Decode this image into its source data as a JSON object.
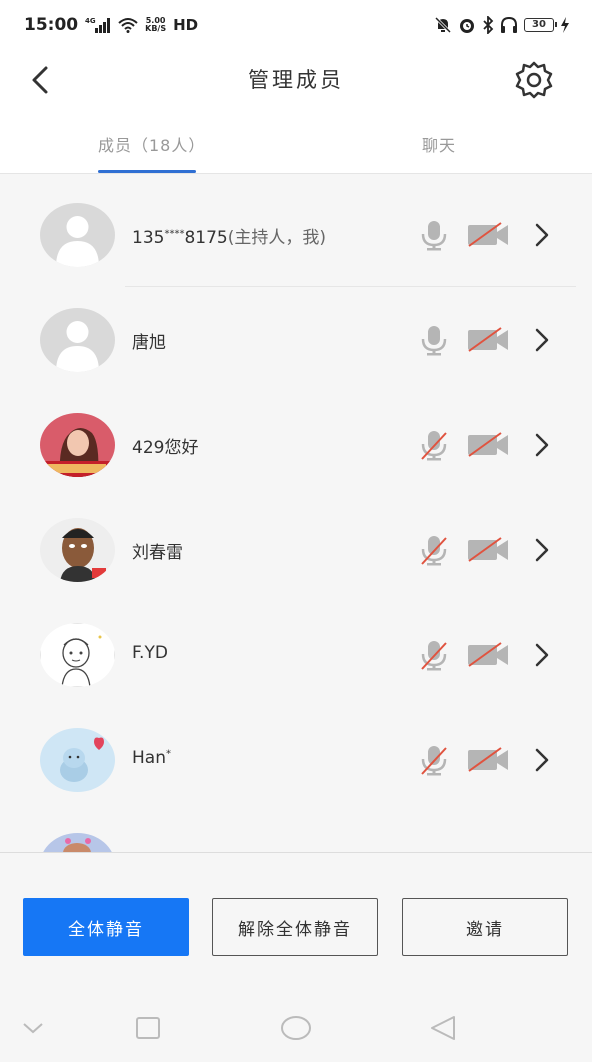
{
  "status_bar": {
    "time": "15:00",
    "signal_type": "4G",
    "net_speed_value": "5.00",
    "net_speed_unit": "KB/S",
    "hd": "HD",
    "battery": "30"
  },
  "header": {
    "title": "管理成员"
  },
  "tabs": {
    "members": "成员（18人）",
    "chat": "聊天"
  },
  "members": [
    {
      "name": "135",
      "name_mid": "****",
      "name_end": "8175",
      "role": "(主持人，我)",
      "avatar": "default",
      "mic_muted": false,
      "camera_off": true
    },
    {
      "name": "唐旭",
      "avatar": "default",
      "mic_muted": false,
      "camera_off": true
    },
    {
      "name": "429您好",
      "avatar": "photo",
      "mic_muted": true,
      "camera_off": true
    },
    {
      "name": "刘春雷",
      "avatar": "cartoon-man",
      "mic_muted": true,
      "camera_off": true
    },
    {
      "name": "F.YD",
      "avatar": "sketch",
      "mic_muted": true,
      "camera_off": true
    },
    {
      "name": "Han",
      "name_sup": "*",
      "avatar": "cartoon-bear",
      "mic_muted": true,
      "camera_off": true
    }
  ],
  "buttons": {
    "mute_all": "全体静音",
    "unmute_all": "解除全体静音",
    "invite": "邀请"
  },
  "colors": {
    "accent": "#1677f5",
    "tab_underline": "#2f6fd3",
    "mute_slash": "#e0533f",
    "icon_gray": "#b5b5b5"
  }
}
